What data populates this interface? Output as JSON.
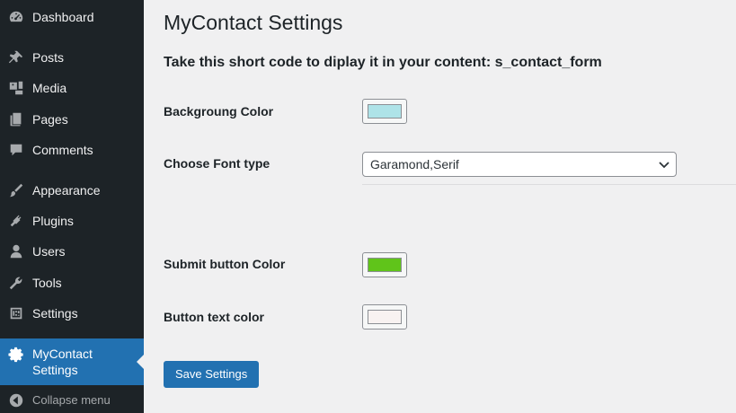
{
  "sidebar": {
    "items": [
      {
        "label": "Dashboard",
        "icon": "dashboard-icon"
      },
      {
        "label": "Posts",
        "icon": "pin-icon"
      },
      {
        "label": "Media",
        "icon": "media-icon"
      },
      {
        "label": "Pages",
        "icon": "pages-icon"
      },
      {
        "label": "Comments",
        "icon": "comment-icon"
      },
      {
        "label": "Appearance",
        "icon": "brush-icon"
      },
      {
        "label": "Plugins",
        "icon": "plug-icon"
      },
      {
        "label": "Users",
        "icon": "user-icon"
      },
      {
        "label": "Tools",
        "icon": "wrench-icon"
      },
      {
        "label": "Settings",
        "icon": "sliders-icon"
      }
    ],
    "active": {
      "label_line1": "MyContact",
      "label_line2": "Settings",
      "icon": "gear-icon"
    },
    "collapse_label": "Collapse menu"
  },
  "main": {
    "title": "MyContact Settings",
    "shortcode_text": "Take this short code to diplay it in your content: s_contact_form",
    "fields": {
      "background_color": {
        "label": "Backgroung Color",
        "value": "#aee3e8"
      },
      "font_type": {
        "label": "Choose Font type",
        "value": "Garamond,Serif"
      },
      "submit_button_color": {
        "label": "Submit button Color",
        "value": "#60c41a"
      },
      "button_text_color": {
        "label": "Button text color",
        "value": "#f8f2f1"
      }
    },
    "save_label": "Save Settings"
  },
  "colors": {
    "sidebar_bg": "#1d2327",
    "accent": "#2271b1",
    "page_bg": "#f0f0f1"
  }
}
